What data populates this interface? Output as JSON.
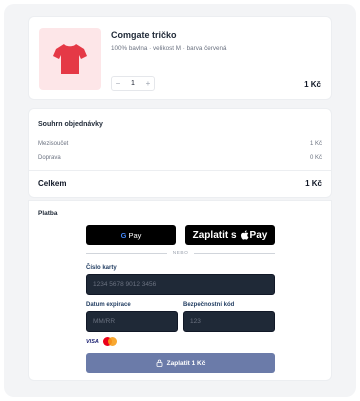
{
  "product": {
    "name": "Comgate tričko",
    "description": "100% bavlna · velikost M · barva červená",
    "quantity": "1",
    "minus_label": "−",
    "plus_label": "+",
    "price": "1 Kč",
    "image_color": "#e53946",
    "image_bg": "#fde6e8",
    "image_icon": "tshirt-icon"
  },
  "summary": {
    "title": "Souhrn objednávky",
    "subtotal_label": "Mezisoučet",
    "subtotal_value": "1 Kč",
    "shipping_label": "Doprava",
    "shipping_value": "0 Kč",
    "total_label": "Celkem",
    "total_value": "1 Kč"
  },
  "payment": {
    "title": "Platba",
    "google_pay": {
      "g": "G",
      "label": "Pay"
    },
    "apple_pay": {
      "prefix": "Zaplatit s",
      "label": "Pay"
    },
    "or_text": "NEBO",
    "card_number_label": "Číslo karty",
    "card_number_placeholder": "1234 5678 9012 3456",
    "expiry_label": "Datum expirace",
    "expiry_placeholder": "MM/RR",
    "cvc_label": "Bezpečnostní kód",
    "cvc_placeholder": "123",
    "brands": {
      "visa": "VISA",
      "mastercard_icon": "mastercard-icon"
    },
    "pay_button": "Zaplatit 1 Kč",
    "pay_button_color": "#6b7ba9"
  }
}
